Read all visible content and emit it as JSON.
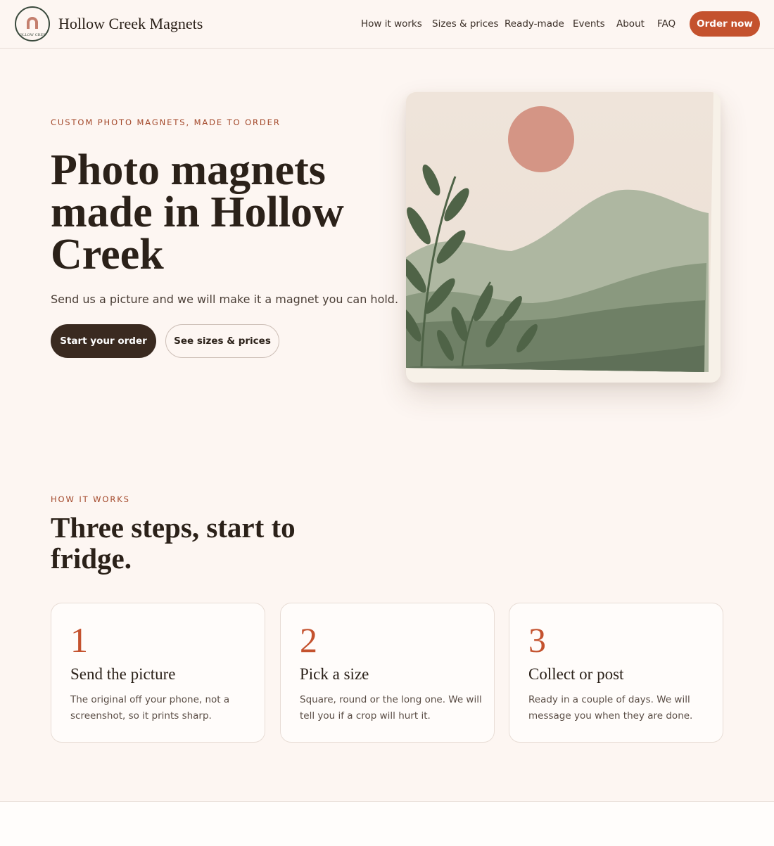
{
  "header": {
    "logo_text": "HOLLOW CREEK",
    "brand": "Hollow Creek Magnets",
    "nav": [
      "How it works",
      "Sizes & prices",
      "Ready-made",
      "Events",
      "About",
      "FAQ"
    ],
    "order_label": "Order now"
  },
  "hero": {
    "eyebrow": "CUSTOM PHOTO MAGNETS, MADE TO ORDER",
    "title": "Photo magnets made in Hollow Creek",
    "subtitle": "Send us a picture and we will make it a magnet you can hold.",
    "primary_cta": "Start your order",
    "secondary_cta": "See sizes & prices"
  },
  "how": {
    "eyebrow": "HOW IT WORKS",
    "title": "Three steps, start to fridge.",
    "steps": [
      {
        "num": "1",
        "title": "Send the picture",
        "text": "The original off your phone, not a screenshot, so it prints sharp."
      },
      {
        "num": "2",
        "title": "Pick a size",
        "text": "Square, round or the long one. We will tell you if a crop will hurt it."
      },
      {
        "num": "3",
        "title": "Collect or post",
        "text": "Ready in a couple of days. We will message you when they are done."
      }
    ]
  },
  "colors": {
    "accent": "#c4522e",
    "background": "#fdf6f2",
    "dark": "#3a2a20",
    "sage": "#6e7f66"
  }
}
